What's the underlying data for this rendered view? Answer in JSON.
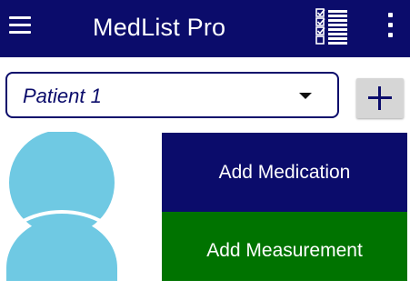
{
  "app_bar": {
    "title": "MedList Pro",
    "background": "#0b0c6b",
    "icons": {
      "menu": "menu-icon",
      "checklist": "checklist-icon",
      "overflow": "more-vert-icon"
    }
  },
  "patient_selector": {
    "selected_value": "Patient 1",
    "icon": "dropdown-caret-icon"
  },
  "add_patient_button": {
    "icon": "plus-icon"
  },
  "avatar": {
    "icon": "person-avatar-icon",
    "color": "#6fc9e3"
  },
  "actions": {
    "add_medication_label": "Add Medication",
    "add_medication_color": "#0b0c6b",
    "add_measurement_label": "Add Measurement",
    "add_measurement_color": "#007300"
  }
}
